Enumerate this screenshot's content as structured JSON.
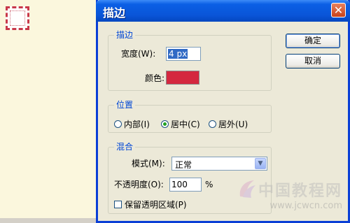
{
  "dialog": {
    "title": "描边",
    "close_glyph": "✕",
    "ok_label": "确定",
    "cancel_label": "取消"
  },
  "stroke": {
    "group_title": "描边",
    "width_label": "宽度(W):",
    "width_value": "4 px",
    "color_label": "颜色:",
    "color_value": "#d4283f"
  },
  "location": {
    "group_title": "位置",
    "options": [
      {
        "label": "内部(I)",
        "selected": false
      },
      {
        "label": "居中(C)",
        "selected": true
      },
      {
        "label": "居外(U)",
        "selected": false
      }
    ]
  },
  "blending": {
    "group_title": "混合",
    "mode_label": "模式(M):",
    "mode_value": "正常",
    "opacity_label": "不透明度(O):",
    "opacity_value": "100",
    "opacity_unit": "%",
    "preserve_label": "保留透明区域(P)",
    "preserve_checked": false
  },
  "watermark": {
    "line1": "中国教程网",
    "line2": "www.jcwcn.com"
  },
  "icons": {
    "close": "close-icon",
    "dropdown": "chevron-down-icon"
  }
}
